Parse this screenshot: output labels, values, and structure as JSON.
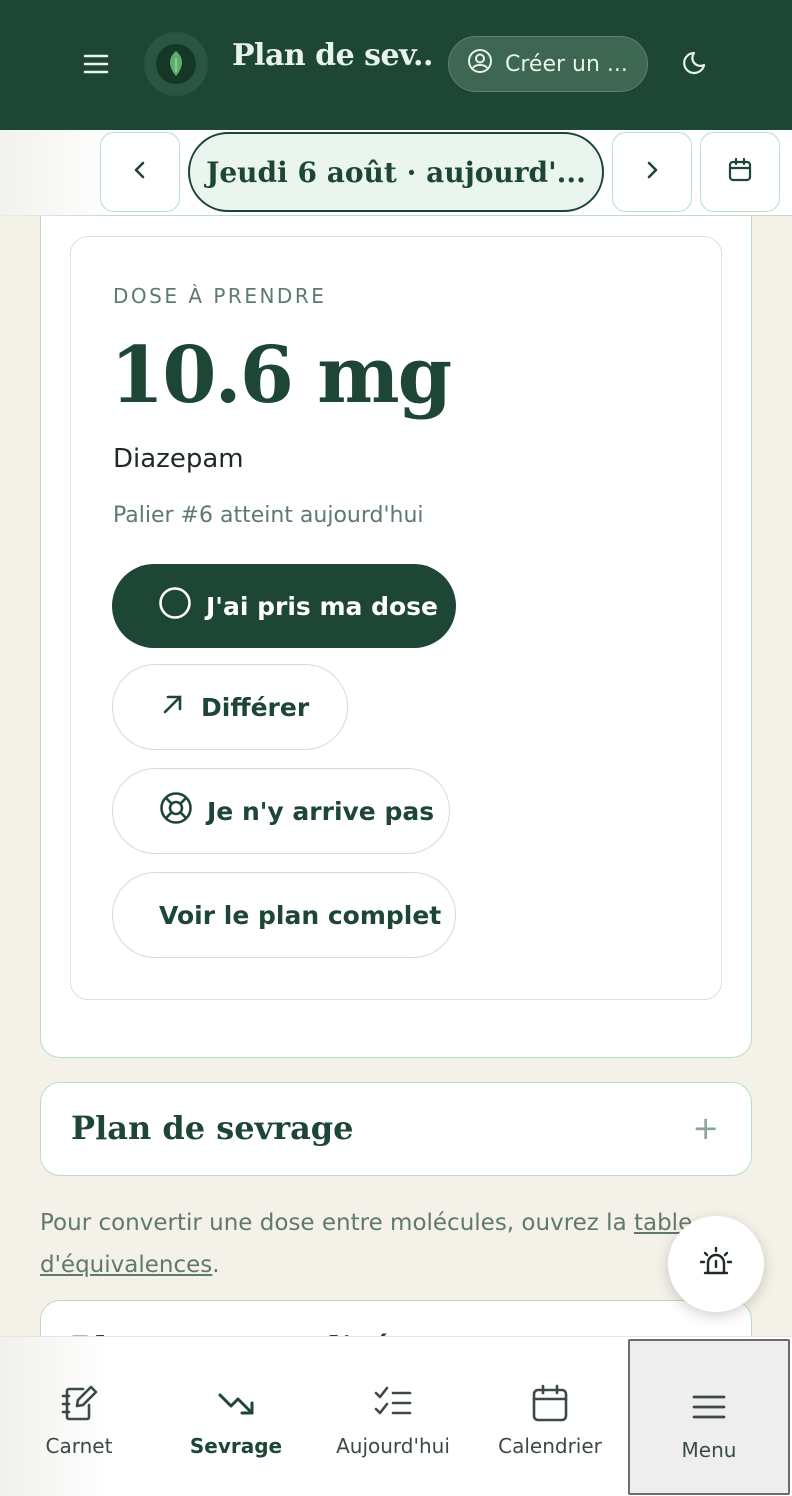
{
  "header": {
    "title": "Plan de sev...",
    "account_label": "Créer un ...",
    "icons": {
      "menu": "hamburger-icon",
      "logo": "leaf-icon",
      "account": "user-circle-icon",
      "theme": "moon-icon"
    }
  },
  "date_nav": {
    "date_label": "Jeudi 6 août · aujourd'...",
    "prev": "chevron-left-icon",
    "next": "chevron-right-icon",
    "calendar": "calendar-icon"
  },
  "dose": {
    "label": "DOSE À PRENDRE",
    "value": "10.6 mg",
    "drug": "Diazepam",
    "step_note": "Palier #6 atteint aujourd'hui",
    "buttons": {
      "taken": "J'ai pris ma dose",
      "defer": "Différer",
      "cannot": "Je n'y arrive pas",
      "full_plan": "Voir le plan complet"
    }
  },
  "accordion": {
    "title": "Plan de sevrage",
    "toggle": "+"
  },
  "convert": {
    "before": "Pour convertir une dose entre molécules, ouvrez la ",
    "link": "table d'équivalences",
    "after": "."
  },
  "peek_card": {
    "title": "Plan personnalisé"
  },
  "bottom_nav": {
    "items": [
      {
        "label": "Carnet",
        "icon": "notebook-pen-icon"
      },
      {
        "label": "Sevrage",
        "icon": "trending-down-icon"
      },
      {
        "label": "Aujourd'hui",
        "icon": "checklist-icon"
      },
      {
        "label": "Calendrier",
        "icon": "calendar-icon"
      },
      {
        "label": "Menu",
        "icon": "menu-icon"
      }
    ],
    "active": "Sevrage"
  },
  "colors": {
    "primary": "#1e4634",
    "accent_border": "#b9dec4",
    "background": "#f4f1e8",
    "muted_text": "#5e7a6c"
  }
}
